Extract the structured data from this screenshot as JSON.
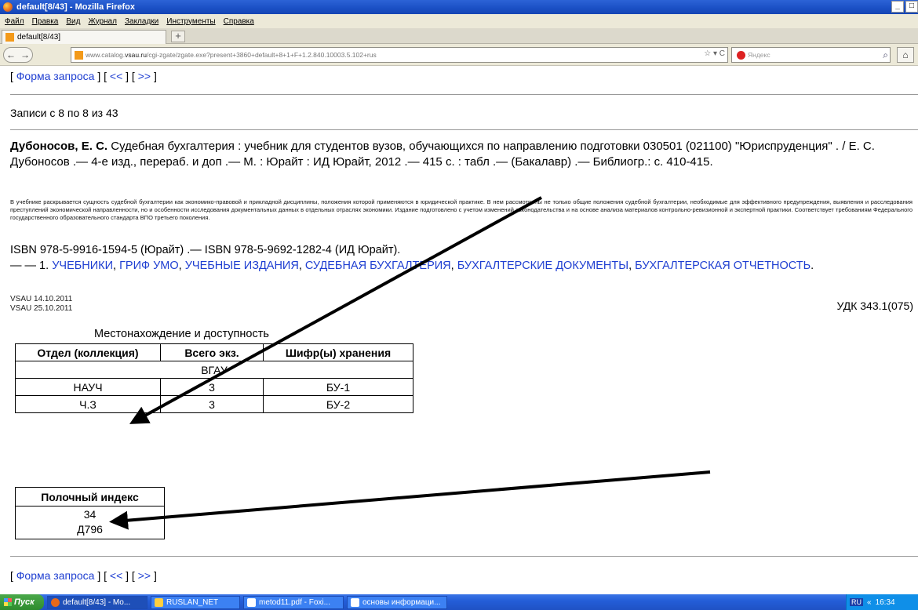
{
  "window": {
    "title": "default[8/43] - Mozilla Firefox",
    "controls": [
      "_",
      "□"
    ]
  },
  "menu": [
    "Файл",
    "Правка",
    "Вид",
    "Журнал",
    "Закладки",
    "Инструменты",
    "Справка"
  ],
  "tab": {
    "label": "default[8/43]",
    "new_tab": "+"
  },
  "nav": {
    "back": "←",
    "forward": "→",
    "url_prefix": "www.catalog.",
    "url_domain": "vsau.ru",
    "url_rest": "/cgi-zgate/zgate.exe?present+3860+default+8+1+F+1.2.840.10003.5.102+rus",
    "url_controls": "☆ ▾ C",
    "search_placeholder": "Яндекс",
    "search_button": "⌕",
    "home": "⌂"
  },
  "page": {
    "nav_top": {
      "open": "[ ",
      "request_form": "Форма запроса",
      "mid1": " ] [ ",
      "prev": "<<",
      "mid2": " ] [ ",
      "next": ">>",
      "close": " ]"
    },
    "records_text": "Записи с 8 по 8 из 43",
    "author": "Дубоносов, Е. С.",
    "biblio_text": " Судебная бухгалтерия : учебник для студентов вузов, обучающихся по направлению подготовки 030501 (021100) \"Юриспруденция\" . / Е. С. Дубоносов .— 4-е изд., перераб. и доп .— М. : Юрайт : ИД Юрайт, 2012 .— 415 с. : табл .— (Бакалавр) .— Библиогр.: с. 410-415.",
    "abstract": "В учебнике раскрывается сущность судебной бухгалтерии как экономико-правовой и прикладной дисциплины, положения которой применяются в юридической практике. В нем рассмотрены не только общие положения судебной бухгалтерии, необходимые для эффективного предупреждения, выявления и расследования преступлений экономической направленности, но и особенности исследования документальных данных в отдельных отраслях экономики. Издание подготовлено с учетом изменений законодательства и на основе анализа материалов контрольно-ревизионной и экспертной практики. Соответствует требованиям Федерального государственного образовательного стандарта ВПО третьего поколения.",
    "isbn": "ISBN 978-5-9916-1594-5 (Юрайт) .— ISBN 978-5-9692-1282-4 (ИД Юрайт).",
    "subjects_prefix": "— — 1. ",
    "subjects": [
      "УЧЕБНИКИ",
      "ГРИФ УМО",
      "УЧЕБНЫЕ ИЗДАНИЯ",
      "СУДЕБНАЯ БУХГАЛТЕРИЯ",
      "БУХГАЛТЕРСКИЕ ДОКУМЕНТЫ",
      "БУХГАЛТЕРСКАЯ ОТЧЕТНОСТЬ"
    ],
    "subject_sep": ", ",
    "subjects_end": ".",
    "dates": [
      "VSAU 14.10.2011",
      "VSAU 25.10.2011"
    ],
    "udk": "УДК 343.1(075)",
    "availability": {
      "title": "Местонахождение и доступность",
      "headers": [
        "Отдел (коллекция)",
        "Всего экз.",
        "Шифр(ы) хранения"
      ],
      "group": "ВГАУ",
      "rows": [
        [
          "НАУЧ",
          "3",
          "БУ-1"
        ],
        [
          "Ч.З",
          "3",
          "БУ-2"
        ]
      ]
    },
    "shelf": {
      "header": "Полочный индекс",
      "values": [
        "34",
        "Д796"
      ]
    }
  },
  "taskbar": {
    "start": "Пуск",
    "tasks": [
      "default[8/43] - Mo...",
      "RUSLAN_NET",
      "metod11.pdf - Foxi...",
      "основы информаци..."
    ],
    "lang": "RU",
    "chevron": "«",
    "clock": "16:34"
  }
}
